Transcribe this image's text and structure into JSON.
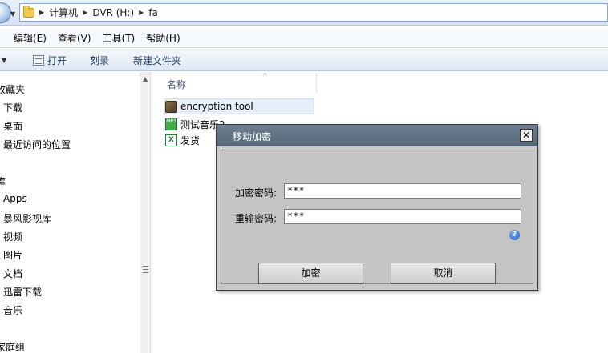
{
  "address": {
    "crumbs": [
      "计算机",
      "DVR (H:)",
      "fa"
    ]
  },
  "menu": {
    "items": [
      "编辑(E)",
      "查看(V)",
      "工具(T)",
      "帮助(H)"
    ]
  },
  "toolbar": {
    "open_label": "打开",
    "burn_label": "刻录",
    "new_folder_label": "新建文件夹"
  },
  "nav": {
    "favorites_header": "收藏夹",
    "favorites": [
      "下载",
      "桌面",
      "最近访问的位置"
    ],
    "libraries_header": "库",
    "libraries": [
      "Apps",
      "暴风影视库",
      "视频",
      "图片",
      "文档",
      "迅雷下载",
      "音乐"
    ],
    "homegroup_header": "家庭组"
  },
  "content": {
    "column_name": "名称",
    "files": [
      {
        "name": "encryption tool",
        "icon": "exe-icon"
      },
      {
        "name": "测试音乐2",
        "icon": "mp3-icon"
      },
      {
        "name": "发货",
        "icon": "xls-icon"
      }
    ]
  },
  "dialog": {
    "title": "移动加密",
    "close_glyph": "✕",
    "password_label": "加密密码:",
    "password_value": "***",
    "confirm_label": "重输密码:",
    "confirm_value": "***",
    "help_glyph": "?",
    "encrypt_button": "加密",
    "cancel_button": "取消"
  }
}
